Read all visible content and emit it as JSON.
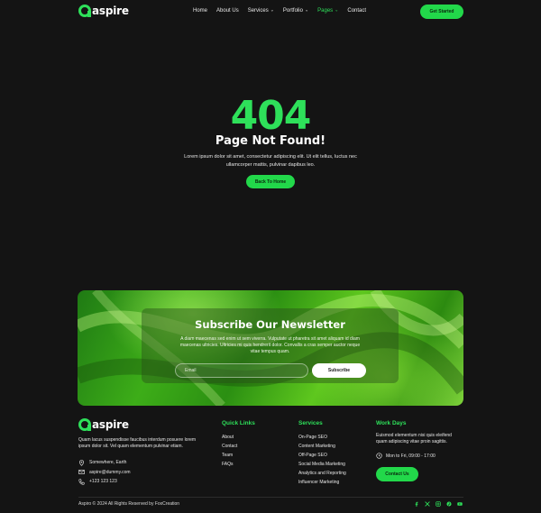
{
  "brand": {
    "name": "aspire"
  },
  "nav": {
    "items": [
      {
        "label": "Home",
        "dropdown": false,
        "active": false
      },
      {
        "label": "About Us",
        "dropdown": false,
        "active": false
      },
      {
        "label": "Services",
        "dropdown": true,
        "active": false
      },
      {
        "label": "Portfolio",
        "dropdown": true,
        "active": false
      },
      {
        "label": "Pages",
        "dropdown": true,
        "active": true
      },
      {
        "label": "Contact",
        "dropdown": false,
        "active": false
      }
    ],
    "cta_label": "Get Started"
  },
  "error": {
    "code": "404",
    "title": "Page Not Found!",
    "text": "Lorem ipsum dolor sit amet, consectetur adipiscing elit. Ut elit tellus, luctus nec ullamcorper mattis, pulvinar dapibus leo.",
    "button_label": "Back To Home"
  },
  "newsletter": {
    "title": "Subscribe Our Newsletter",
    "text": "A diam maecenas sed enim ut sem viverra. Vulputate ut pharetra sit amet aliquam id diam maecenas ultricies. Ultricies mi quis hendrerit dolor. Convallis a cras semper auctor neque vitae tempus quam.",
    "input_placeholder": "Email",
    "button_label": "Subscribe"
  },
  "footer": {
    "about": "Quam lacus suspendisse faucibus interdum posuere lorem ipsum dolor sit. Vel quam elementum pulvinar etiam.",
    "address": "Somewhere, Earth",
    "email": "aspire@dummy.com",
    "phone": "+123 123 123",
    "quick_links": {
      "title": "Quick Links",
      "items": [
        "About",
        "Contact",
        "Team",
        "FAQs"
      ]
    },
    "services": {
      "title": "Services",
      "items": [
        "On-Page SEO",
        "Content Marketing",
        "Off-Page SEO",
        "Social Media Marketing",
        "Analytics and Reporting",
        "Influencer Marketing"
      ]
    },
    "work_days": {
      "title": "Work Days",
      "text": "Euismod elementum nisi quis eleifend quam adipiscing vitae proin sagittis.",
      "hours": "Mon to Fri, 09:00 - 17:00",
      "button_label": "Contact Us"
    },
    "copyright": "Aspiro © 2024 All Rights Reserved by FoxCreation",
    "socials": [
      "facebook-icon",
      "x-icon",
      "instagram-icon",
      "pinterest-icon",
      "youtube-icon"
    ]
  },
  "colors": {
    "accent": "#2ee05a",
    "background": "#141414"
  }
}
